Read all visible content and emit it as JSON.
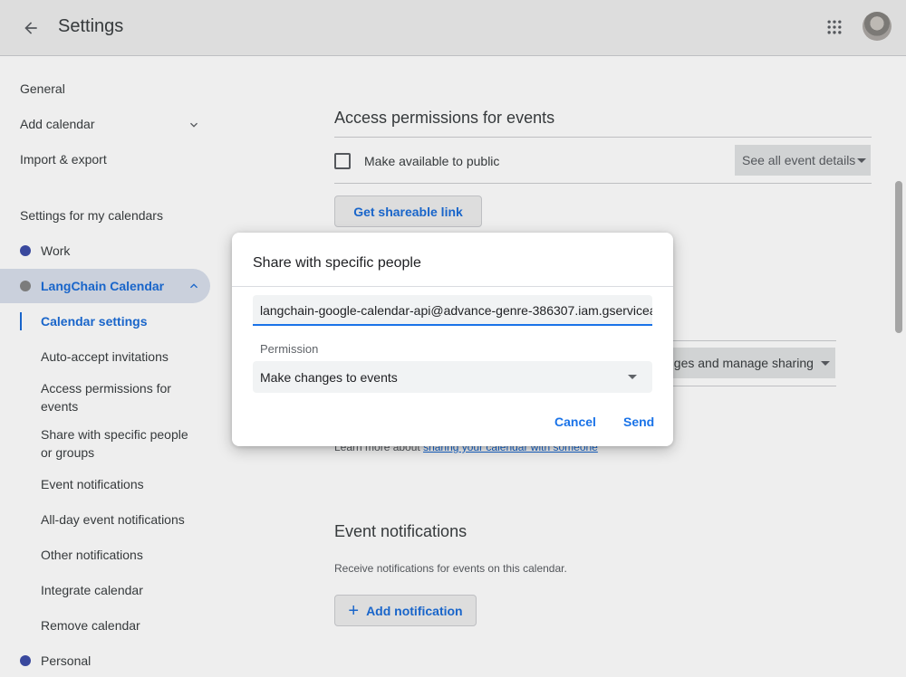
{
  "header": {
    "title": "Settings"
  },
  "sidebar": {
    "general": "General",
    "add_calendar": "Add calendar",
    "import_export": "Import & export",
    "my_calendars_header": "Settings for my calendars",
    "calendars": [
      {
        "name": "Work",
        "color": "#3f51b5"
      },
      {
        "name": "LangChain Calendar",
        "color": "#8e8e8e"
      },
      {
        "name": "Personal",
        "color": "#3f51b5"
      }
    ],
    "sub_items": [
      "Calendar settings",
      "Auto-accept invitations",
      "Access permissions for events",
      "Share with specific people or groups",
      "Event notifications",
      "All-day event notifications",
      "Other notifications",
      "Integrate calendar",
      "Remove calendar"
    ]
  },
  "main": {
    "access_title": "Access permissions for events",
    "make_public_label": "Make available to public",
    "see_all_select": "See all event details",
    "shareable_link_button": "Get shareable link",
    "manage_sharing_select": "nges and manage sharing",
    "learn_more_prefix": "Learn more about ",
    "learn_more_link": "sharing your calendar with someone",
    "event_notifications_title": "Event notifications",
    "event_notifications_desc": "Receive notifications for events on this calendar.",
    "add_notification_button": "Add notification"
  },
  "dialog": {
    "title": "Share with specific people",
    "email_value": "langchain-google-calendar-api@advance-genre-386307.iam.gserviceac",
    "permission_label": "Permission",
    "permission_value": "Make changes to events",
    "cancel_label": "Cancel",
    "send_label": "Send"
  },
  "colors": {
    "accent": "#1a73e8",
    "active_bg": "#e8f0fe"
  }
}
